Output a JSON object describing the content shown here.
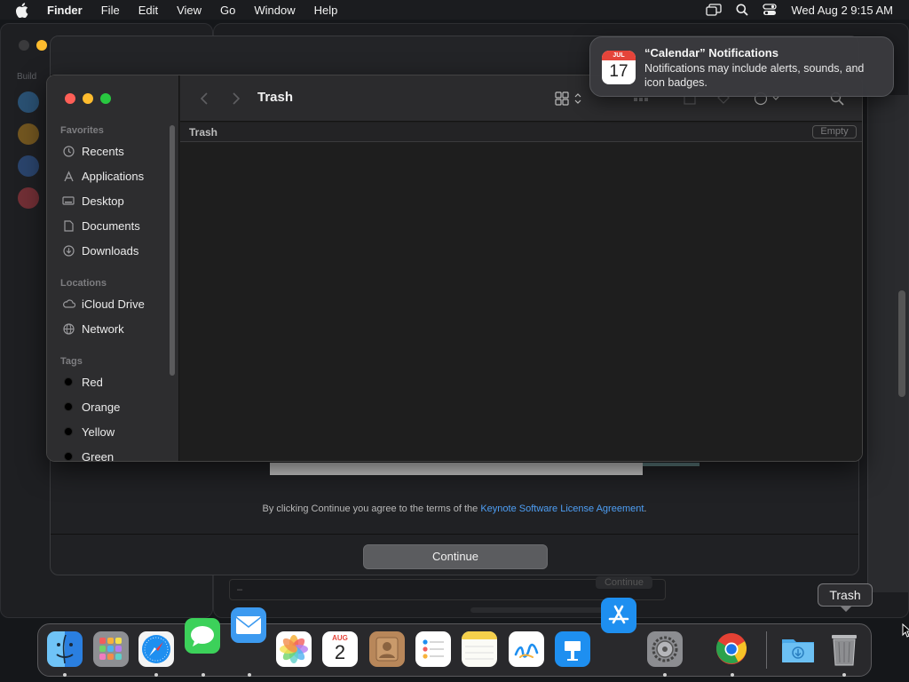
{
  "menubar": {
    "app_name": "Finder",
    "items": [
      "File",
      "Edit",
      "View",
      "Go",
      "Window",
      "Help"
    ],
    "clock": "Wed Aug 2  9:15 AM",
    "icons": [
      "apple-icon",
      "screen-mirroring-icon",
      "search-icon",
      "control-center-icon"
    ]
  },
  "background_window": {
    "sidebar_label": "Build",
    "license_prefix": "By clicking Continue you agree to the terms of the ",
    "license_link": "Keynote Software License Agreement",
    "license_suffix": ".",
    "continue_label": "Continue",
    "ghost_button": "Continue",
    "field_text": "–"
  },
  "finder": {
    "title": "Trash",
    "path_label": "Trash",
    "empty_label": "Empty",
    "sidebar": {
      "favorites_header": "Favorites",
      "favorites": [
        {
          "label": "Recents",
          "icon": "clock-icon"
        },
        {
          "label": "Applications",
          "icon": "applications-icon"
        },
        {
          "label": "Desktop",
          "icon": "desktop-icon"
        },
        {
          "label": "Documents",
          "icon": "document-icon"
        },
        {
          "label": "Downloads",
          "icon": "download-icon"
        }
      ],
      "locations_header": "Locations",
      "locations": [
        {
          "label": "iCloud Drive",
          "icon": "cloud-icon"
        },
        {
          "label": "Network",
          "icon": "globe-icon"
        }
      ],
      "tags_header": "Tags",
      "tags": [
        {
          "label": "Red"
        },
        {
          "label": "Orange"
        },
        {
          "label": "Yellow"
        },
        {
          "label": "Green"
        }
      ]
    }
  },
  "notification": {
    "title": "“Calendar” Notifications",
    "body": "Notifications may include alerts, sounds, and icon badges.",
    "icon_month": "JUL",
    "icon_day": "17"
  },
  "dock": {
    "tooltip": "Trash",
    "calendar_month": "AUG",
    "calendar_day": "2",
    "apps": [
      "Finder",
      "Launchpad",
      "Safari",
      "Messages",
      "Mail",
      "Photos",
      "Calendar",
      "Contacts",
      "Reminders",
      "Notes",
      "Freeform",
      "Keynote",
      "App Store",
      "System Settings",
      "Chrome",
      "Downloads",
      "Trash"
    ]
  },
  "colors": {
    "accent_link": "#4e9ff5",
    "traffic_red": "#ff5f57",
    "traffic_yellow": "#febc2e",
    "traffic_green": "#28c840"
  }
}
